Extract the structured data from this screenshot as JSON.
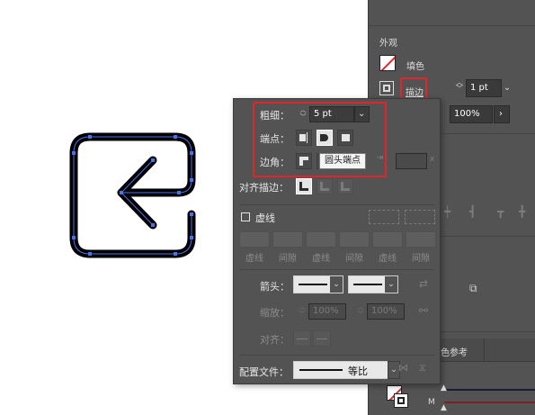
{
  "bg_panel": {
    "section_appearance": "外观",
    "fill_label": "填色",
    "stroke_label": "描边",
    "stroke_weight": "1 pt",
    "opacity": "100%",
    "tab_color_guide": "色参考",
    "fx_letter": "M"
  },
  "popup": {
    "weight_label": "粗细：",
    "weight_value": "5 pt",
    "cap_label": "端点：",
    "corner_label": "边角：",
    "align_label": "对齐描边：",
    "dashed_label": "虚线",
    "dash_labels": [
      "虚线",
      "间隙",
      "虚线",
      "间隙",
      "虚线",
      "间隙"
    ],
    "arrow_label": "箭头：",
    "scale_label": "缩放：",
    "scale_start": "100%",
    "scale_end": "100%",
    "align_arrow_label": "对齐：",
    "profile_label": "配置文件：",
    "profile_value": "等比",
    "tooltip": "圆头端点"
  },
  "colors": {
    "panel_bg": "#535353",
    "highlight_red": "#e0262a",
    "anchor_blue": "#4a72e8",
    "shape_stroke": "#000000"
  }
}
